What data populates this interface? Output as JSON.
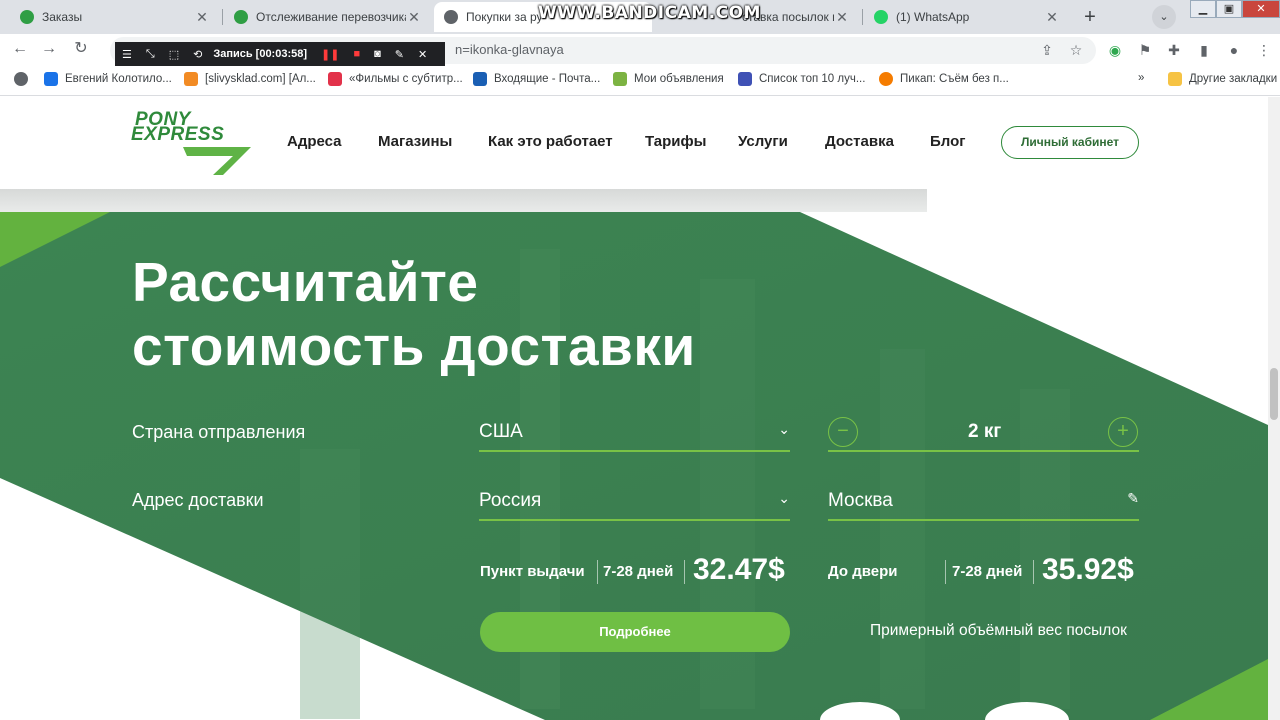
{
  "browser": {
    "tabs": [
      {
        "title": "Заказы",
        "favicon_color": "#2f9e44"
      },
      {
        "title": "Отслеживание перевозчика",
        "favicon_color": "#2f9e44"
      },
      {
        "title": "Покупки за ру",
        "favicon_color": "#5f6368"
      },
      {
        "title": "ставка посылок и",
        "favicon_color": "#5f6368"
      },
      {
        "title": "(1) WhatsApp",
        "favicon_color": "#25d366"
      }
    ],
    "watermark": "WWW.BANDICAM.COM",
    "url_fragment": "n=ikonka-glavnaya",
    "recorder": {
      "label": "Запись [00:03:58]"
    },
    "bookmarks": [
      {
        "label": "Евгений Колотило...",
        "color": "#1a73e8"
      },
      {
        "label": "[slivysklad.com] [Ал...",
        "color": "#f28b24"
      },
      {
        "label": "«Фильмы с субтитр...",
        "color": "#e2324a"
      },
      {
        "label": "Входящие - Почта...",
        "color": "#1a5fb4"
      },
      {
        "label": "Мои объявления",
        "color": "#7cb342"
      },
      {
        "label": "Список топ 10 луч...",
        "color": "#3f51b5"
      },
      {
        "label": "Пикап: Съём без п...",
        "color": "#f57c00"
      }
    ],
    "other_bookmarks": "Другие закладки"
  },
  "site": {
    "logo": {
      "line1": "PONY",
      "line2": "EXPRESS"
    },
    "nav": [
      "Адреса",
      "Магазины",
      "Как это работает",
      "Тарифы",
      "Услуги",
      "Доставка",
      "Блог"
    ],
    "cabinet_button": "Личный кабинет"
  },
  "calculator": {
    "title_line1": "Рассчитайте",
    "title_line2": "стоимость доставки",
    "origin_label": "Страна отправления",
    "origin_value": "США",
    "weight_value": "2 кг",
    "address_label": "Адрес доставки",
    "country_value": "Россия",
    "city_value": "Москва",
    "pickup": {
      "label": "Пункт выдачи",
      "days": "7-28 дней",
      "price": "32.47$"
    },
    "door": {
      "label": "До двери",
      "days": "7-28 дней",
      "price": "35.92$"
    },
    "more_button": "Подробнее",
    "approx_link": "Примерный объёмный вес посылок"
  },
  "colors": {
    "green_dark": "#3d7f53",
    "green_accent": "#79c246",
    "button_green": "#6fbf44"
  }
}
